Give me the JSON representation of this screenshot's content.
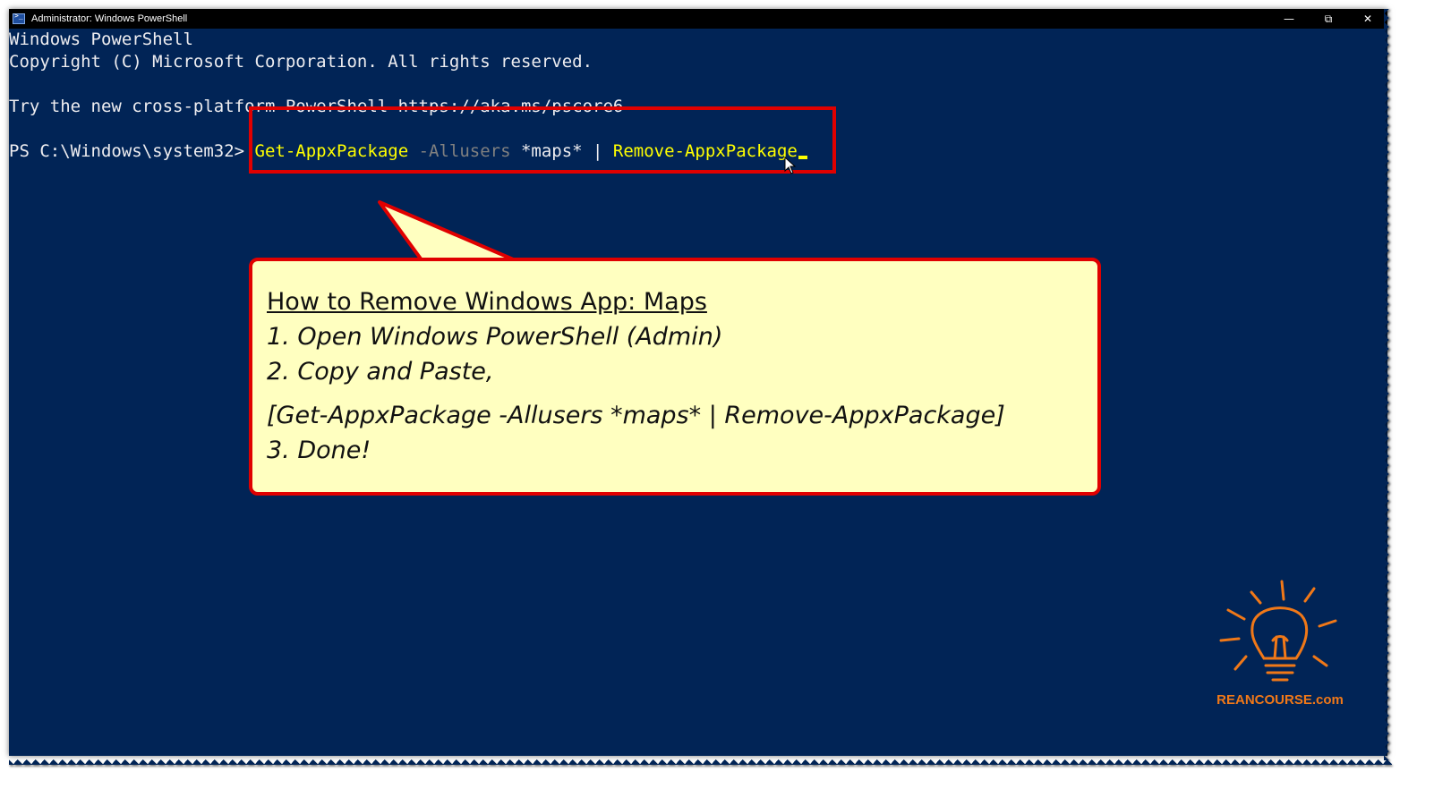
{
  "window": {
    "title": "Administrator: Windows PowerShell",
    "controls": {
      "minimize": "—",
      "restore": "⧉",
      "close": "✕"
    }
  },
  "console": {
    "banner_line1": "Windows PowerShell",
    "banner_line2": "Copyright (C) Microsoft Corporation. All rights reserved.",
    "banner_line3": "Try the new cross-platform PowerShell https://aka.ms/pscore6",
    "prompt": "PS C:\\Windows\\system32> ",
    "command": {
      "cmdlet": "Get-AppxPackage",
      "parameter": " -Allusers",
      "argument": " *maps* | ",
      "cmdlet2": "Remove-AppxPackage"
    }
  },
  "callout": {
    "heading": "How to Remove Windows App: Maps",
    "step1": "1. Open Windows PowerShell (Admin)",
    "step2": "2. Copy and Paste,",
    "command": "[Get-AppxPackage -Allusers *maps* | Remove-AppxPackage]",
    "step3": "3. Done!"
  },
  "logo": {
    "text": "REANCOURSE.com"
  },
  "colors": {
    "console_bg": "#012456",
    "highlight_border": "#e00000",
    "callout_bg": "#ffffc0",
    "logo": "#f07818"
  }
}
